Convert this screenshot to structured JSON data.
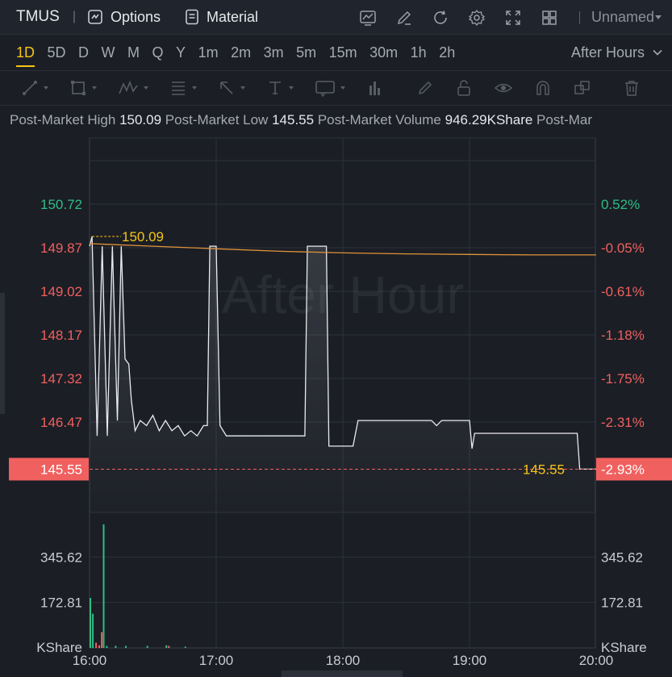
{
  "header": {
    "ticker": "TMUS",
    "options_label": "Options",
    "material_label": "Material",
    "layout_name": "Unnamed",
    "icons": [
      "indicator-icon",
      "draw-edit-icon",
      "refresh-icon",
      "settings-gear-icon",
      "fullscreen-icon",
      "layout-grid-icon"
    ]
  },
  "intervals": {
    "items": [
      "1D",
      "5D",
      "D",
      "W",
      "M",
      "Q",
      "Y",
      "1m",
      "2m",
      "3m",
      "5m",
      "15m",
      "30m",
      "1h",
      "2h"
    ],
    "active": "1D",
    "session": "After Hours"
  },
  "drawing_tools": [
    "trendline-icon",
    "rectangle-icon",
    "pattern-icon",
    "fib-icon",
    "arrow-icon",
    "text-icon",
    "annotation-icon",
    "volume-profile-icon",
    "pen-icon",
    "lock-icon",
    "eye-icon",
    "magnet-icon",
    "copy-icon",
    "trash-icon"
  ],
  "info": {
    "high_label": "Post-Market High",
    "high_value": "150.09",
    "low_label": "Post-Market Low",
    "low_value": "145.55",
    "volume_label": "Post-Market Volume",
    "volume_value": "946.29KShare",
    "more_label": "Post-Mar"
  },
  "chart_data": {
    "type": "line",
    "watermark": "After Hour",
    "price_axis": {
      "ticks": [
        "150.72",
        "149.87",
        "149.02",
        "148.17",
        "147.32",
        "146.47"
      ],
      "current": "145.55",
      "range": [
        145.2,
        151.6
      ]
    },
    "percent_axis": {
      "ticks": [
        "0.52%",
        "-0.05%",
        "-0.61%",
        "-1.18%",
        "-1.75%",
        "-2.31%"
      ],
      "current": "-2.93%"
    },
    "volume_axis": {
      "ticks": [
        "345.62",
        "172.81"
      ],
      "unit": "KShare",
      "range": [
        0,
        500
      ]
    },
    "time_axis": [
      "16:00",
      "17:00",
      "18:00",
      "19:00",
      "20:00"
    ],
    "high_marker": "150.09",
    "last_marker": "145.55",
    "colors": {
      "up": "#2ebd85",
      "down": "#f0605f",
      "price_line": "#e9ebee",
      "avg_line": "#e0933a",
      "marker": "#f5c518"
    },
    "price_series": [
      [
        0,
        149.9
      ],
      [
        0.02,
        150.09
      ],
      [
        0.06,
        146.2
      ],
      [
        0.1,
        149.9
      ],
      [
        0.14,
        146.2
      ],
      [
        0.18,
        149.9
      ],
      [
        0.22,
        146.5
      ],
      [
        0.25,
        149.9
      ],
      [
        0.28,
        147.7
      ],
      [
        0.31,
        147.6
      ],
      [
        0.33,
        146.9
      ],
      [
        0.36,
        146.3
      ],
      [
        0.4,
        146.5
      ],
      [
        0.45,
        146.4
      ],
      [
        0.5,
        146.6
      ],
      [
        0.55,
        146.3
      ],
      [
        0.6,
        146.5
      ],
      [
        0.65,
        146.3
      ],
      [
        0.7,
        146.4
      ],
      [
        0.75,
        146.2
      ],
      [
        0.8,
        146.3
      ],
      [
        0.85,
        146.2
      ],
      [
        0.9,
        146.4
      ],
      [
        0.93,
        146.4
      ],
      [
        0.95,
        149.9
      ],
      [
        1.0,
        149.9
      ],
      [
        1.03,
        146.4
      ],
      [
        1.08,
        146.2
      ],
      [
        1.2,
        146.2
      ],
      [
        1.7,
        146.2
      ],
      [
        1.72,
        149.9
      ],
      [
        1.87,
        149.9
      ],
      [
        1.89,
        146.0
      ],
      [
        2.08,
        146.0
      ],
      [
        2.12,
        146.5
      ],
      [
        2.7,
        146.5
      ],
      [
        2.74,
        146.4
      ],
      [
        2.78,
        146.5
      ],
      [
        3.0,
        146.5
      ],
      [
        3.02,
        145.95
      ],
      [
        3.04,
        146.25
      ],
      [
        3.6,
        146.25
      ],
      [
        3.85,
        146.25
      ],
      [
        3.87,
        145.55
      ],
      [
        4.0,
        145.55
      ]
    ],
    "avg_series": [
      [
        0,
        149.95
      ],
      [
        0.5,
        149.9
      ],
      [
        1.0,
        149.85
      ],
      [
        1.5,
        149.8
      ],
      [
        2.0,
        149.77
      ],
      [
        2.5,
        149.75
      ],
      [
        3.0,
        149.74
      ],
      [
        3.5,
        149.73
      ],
      [
        4.0,
        149.73
      ]
    ],
    "volume_series": [
      [
        0.0,
        190,
        "up"
      ],
      [
        0.02,
        130,
        "up"
      ],
      [
        0.045,
        20,
        "down"
      ],
      [
        0.07,
        10,
        "down"
      ],
      [
        0.09,
        60,
        "down"
      ],
      [
        0.105,
        470,
        "up"
      ],
      [
        0.13,
        8,
        "up"
      ],
      [
        0.2,
        8,
        "up"
      ],
      [
        0.28,
        8,
        "up"
      ],
      [
        0.45,
        8,
        "up"
      ],
      [
        0.6,
        10,
        "up"
      ],
      [
        0.62,
        8,
        "down"
      ],
      [
        0.75,
        5,
        "up"
      ]
    ]
  }
}
